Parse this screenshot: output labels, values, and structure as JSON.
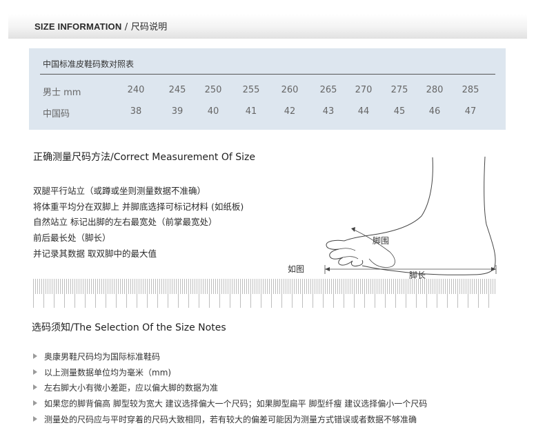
{
  "header": {
    "title_en": "SIZE INFORMATION",
    "title_cn": " / 尺码说明"
  },
  "size_table": {
    "caption": "中国标准皮鞋码数对照表",
    "rows": [
      {
        "label": "男士 mm",
        "values": [
          "240",
          "245",
          "250",
          "255",
          "260",
          "265",
          "270",
          "275",
          "280",
          "285"
        ]
      },
      {
        "label": "中国码",
        "values": [
          "38",
          "39",
          "40",
          "41",
          "42",
          "43",
          "44",
          "45",
          "46",
          "47"
        ]
      }
    ]
  },
  "measurement": {
    "title": "正确测量尺码方法/Correct Measurement Of Size",
    "steps": [
      "双腿平行站立（或蹲或坐则测量数据不准确）",
      "将体重平均分在双脚上  并脚底选择可标记材料 (如纸板)",
      "自然站立  标记出脚的左右最宽处（前掌最宽处）",
      "前后最长处（脚长）",
      "并记录其数据 取双脚中的最大值"
    ],
    "figure_caption": "如图",
    "girth_label": "脚围",
    "length_label": "脚长"
  },
  "notes": {
    "title": "选码须知/The Selection Of the Size Notes",
    "items": [
      "奥康男鞋尺码均为国际标准鞋码",
      "以上测量数据单位均为毫米（mm)",
      "左右脚大小有微小差距，应以偏大脚的数据为准",
      "如果您的脚背偏高 脚型较为宽大 建议选择偏大一个尺码；如果脚型扁平 脚型纤瘦 建议选择偏小一个尺码",
      "测量处的尺码应与平时穿着的尺码大致相同，若有较大的偏差可能因为测量方式错误或者数据不够准确"
    ]
  }
}
